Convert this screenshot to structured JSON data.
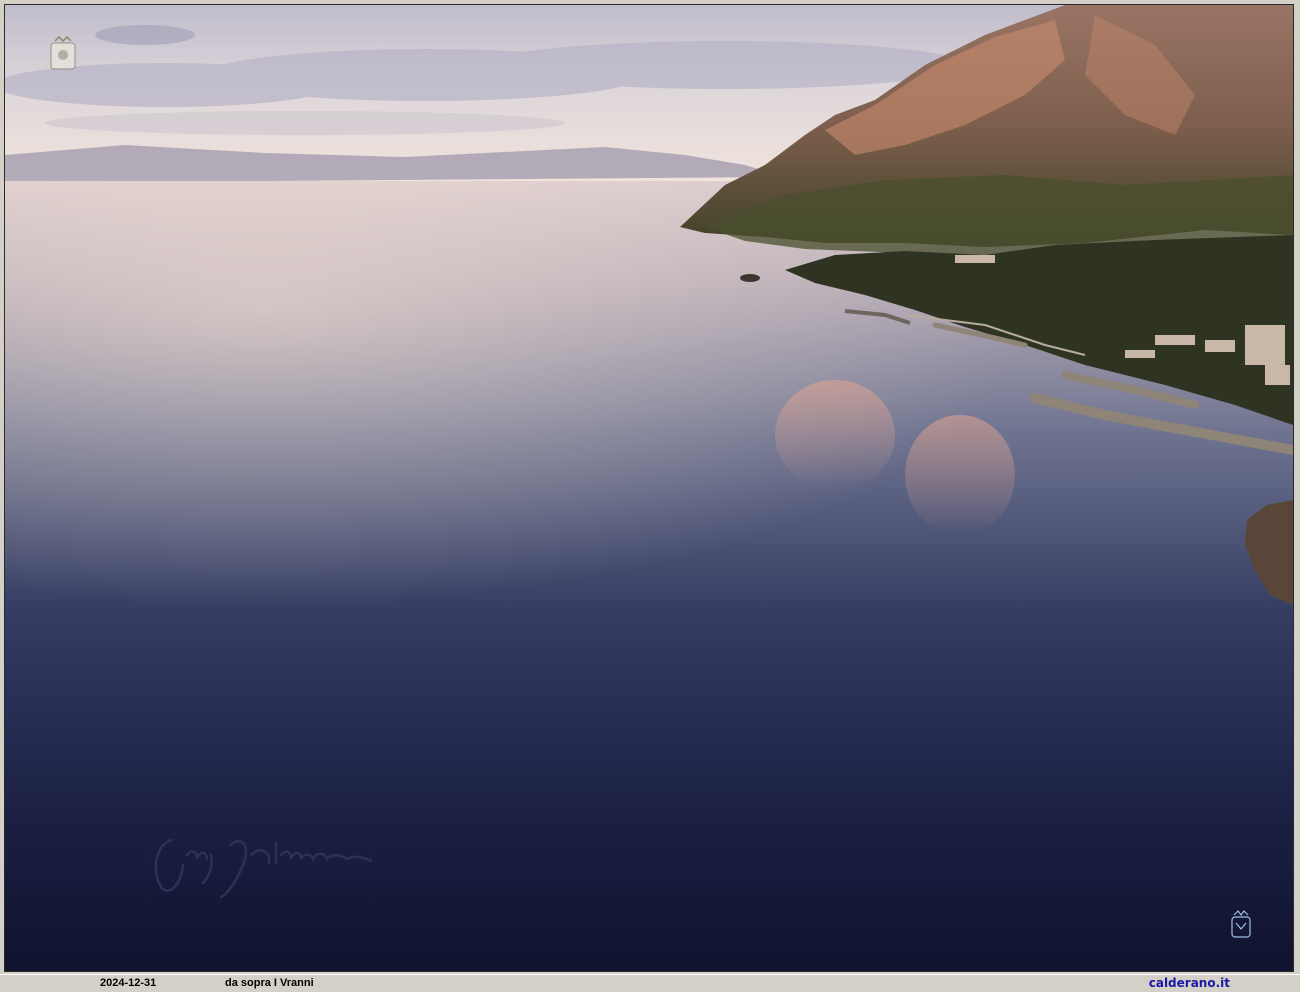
{
  "photo": {
    "subject": "aerial-coastline-sunset",
    "colors": {
      "sky_top": "#c9c6d4",
      "sky_glow": "#f3e6dc",
      "sea_near": "#141938",
      "sea_mid": "#3b4468",
      "sea_far": "#d9c9cc",
      "mountain": "#7a5a4a",
      "mountain_lit": "#c98a6e",
      "vegetation": "#3f4a2c"
    }
  },
  "logos": {
    "top_left": "coat-of-arms-icon",
    "bottom_right": "coat-of-arms-icon"
  },
  "watermark": {
    "type": "handwritten-signature"
  },
  "caption": {
    "date": "2024-12-31",
    "title": "da sopra I Vranni",
    "site": "calderano.it"
  }
}
